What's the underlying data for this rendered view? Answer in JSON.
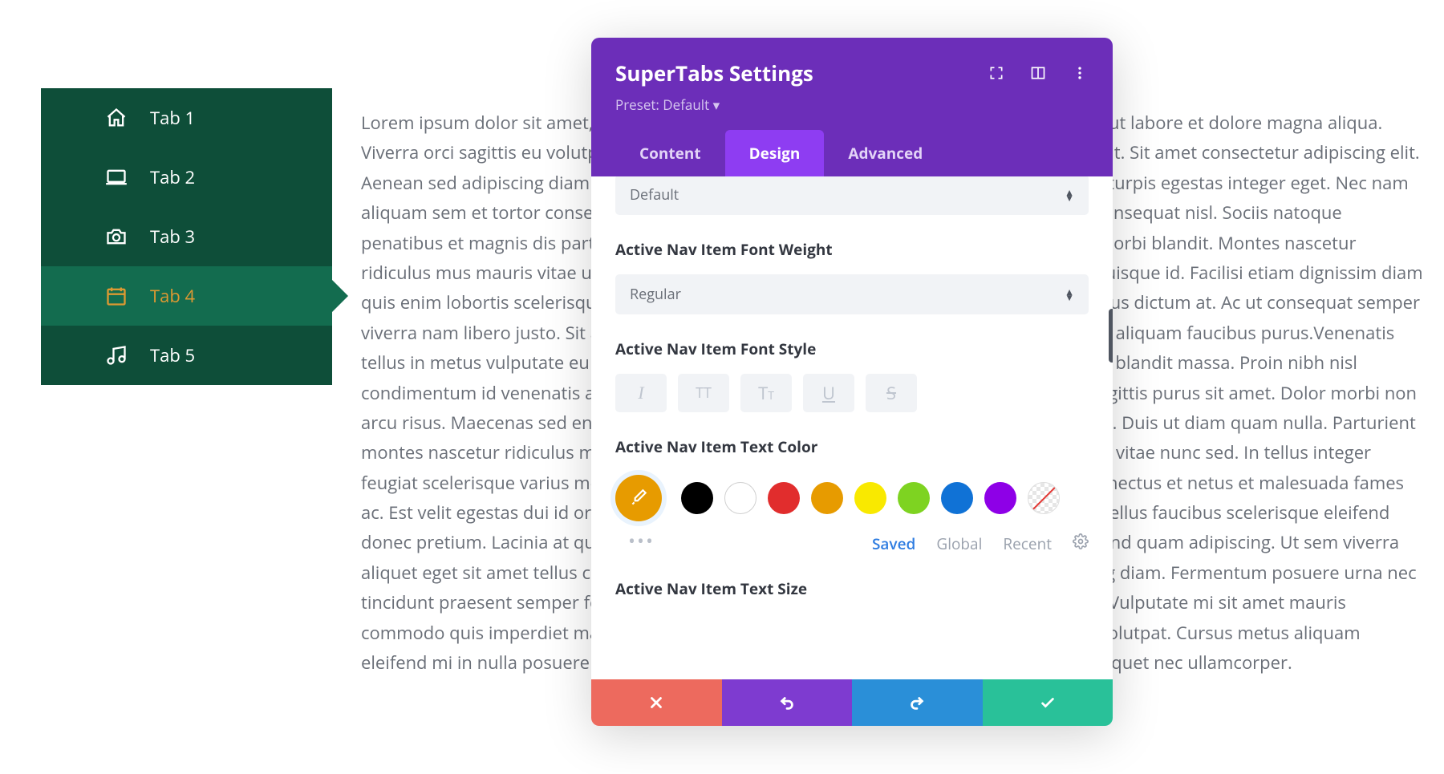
{
  "sidebar": {
    "items": [
      {
        "icon": "home-icon",
        "label": "Tab 1"
      },
      {
        "icon": "laptop-icon",
        "label": "Tab 2"
      },
      {
        "icon": "camera-icon",
        "label": "Tab 3"
      },
      {
        "icon": "calendar-icon",
        "label": "Tab 4"
      },
      {
        "icon": "music-icon",
        "label": "Tab 5"
      }
    ],
    "active_index": 3
  },
  "page_body": "Lorem ipsum dolor sit amet, consectetur adipiscing elit, sed do eiusmod tempor incididunt ut labore et dolore magna aliqua. Viverra orci sagittis eu volutpat odio facilisis mauris sit. Quam viverra orci sagittis eu volutpat. Sit amet consectetur adipiscing elit. Aenean sed adipiscing diam donec adipiscing. Id nibh tortor id aliquet lectus proin nibh. Ac turpis egestas integer eget. Nec nam aliquam sem et tortor consequat id. Cras fermentum odio eu feugiat pretium nibh ipsum consequat nisl. Sociis natoque penatibus et magnis dis parturient montes nascetur. Massa id neque aliquam vestibulum morbi blandit. Montes nascetur ridiculus mus mauris vitae ultricies. Sed arcu non odio euismod lacinia. Quis varius quam quisque id. Facilisi etiam dignissim diam quis enim lobortis scelerisque. Commodo quis imperdiet massa tincidunt nunc. In ante metus dictum at. Ac ut consequat semper viverra nam libero justo. Sit amet risus nullam eget felis eget. Felis eget nunc lobortis mattis aliquam faucibus purus.Venenatis tellus in metus vulputate eu scelerisque. Lobortis elementum nibh tellus molestie nunc non blandit massa. Proin nibh nisl condimentum id venenatis a condimentum vitae. Hac habitasse platea dictumst quisque sagittis purus sit amet. Dolor morbi non arcu risus. Maecenas sed enim ut sem viverra aliquet. Bibendum ut tristique et egestas quis. Duis ut diam quam nulla. Parturient montes nascetur ridiculus mus mauris vitae ultricies leo integer. Vitae elementum curabitur vitae nunc sed. In tellus integer feugiat scelerisque varius morbi enim nunc. Blandit aliquam etiam erat velit scelerisque. Senectus et netus et malesuada fames ac. Est velit egestas dui id ornare arcu odio ut. Ultrices in iaculis nunc sed augue lacus. Phasellus faucibus scelerisque eleifend donec pretium. Lacinia at quis risus sed vulputate odio. Euismod elementum nisi quis eleifend quam adipiscing. Ut sem viverra aliquet eget sit amet tellus cras adipiscing. Morbi quis commodo odio aenean sed adipiscing diam. Fermentum posuere urna nec tincidunt praesent semper feugiat. Turpis cursus in hac habitasse platea dictumst quisque. Vulputate mi sit amet mauris commodo quis imperdiet massa. Viverra nibh cras pulvinar mattis nunc sed blandit libero volutpat. Cursus metus aliquam eleifend mi in nulla posuere sollicitudin aliquam. Id velit ut tortor pretium. Faucibus vitae aliquet nec ullamcorper.",
  "modal": {
    "title": "SuperTabs Settings",
    "preset_label": "Preset: Default",
    "tabs": [
      "Content",
      "Design",
      "Advanced"
    ],
    "tab_active_index": 1,
    "partial_select_value": "Default",
    "sections": {
      "font_weight": {
        "label": "Active Nav Item Font Weight",
        "value": "Regular"
      },
      "font_style": {
        "label": "Active Nav Item Font Style",
        "buttons": [
          "italic",
          "uppercase",
          "titlecase",
          "underline",
          "strikethrough"
        ]
      },
      "text_color": {
        "label": "Active Nav Item Text Color",
        "selected": "#e79b00",
        "swatches": [
          "#000000",
          "#ffffff",
          "#e12d2d",
          "#e79b00",
          "#f9e900",
          "#7ed321",
          "#1072d6",
          "#8e00e7",
          "none"
        ],
        "palette_tabs": [
          "Saved",
          "Global",
          "Recent"
        ],
        "palette_active_index": 0
      },
      "text_size": {
        "label": "Active Nav Item Text Size"
      }
    }
  }
}
